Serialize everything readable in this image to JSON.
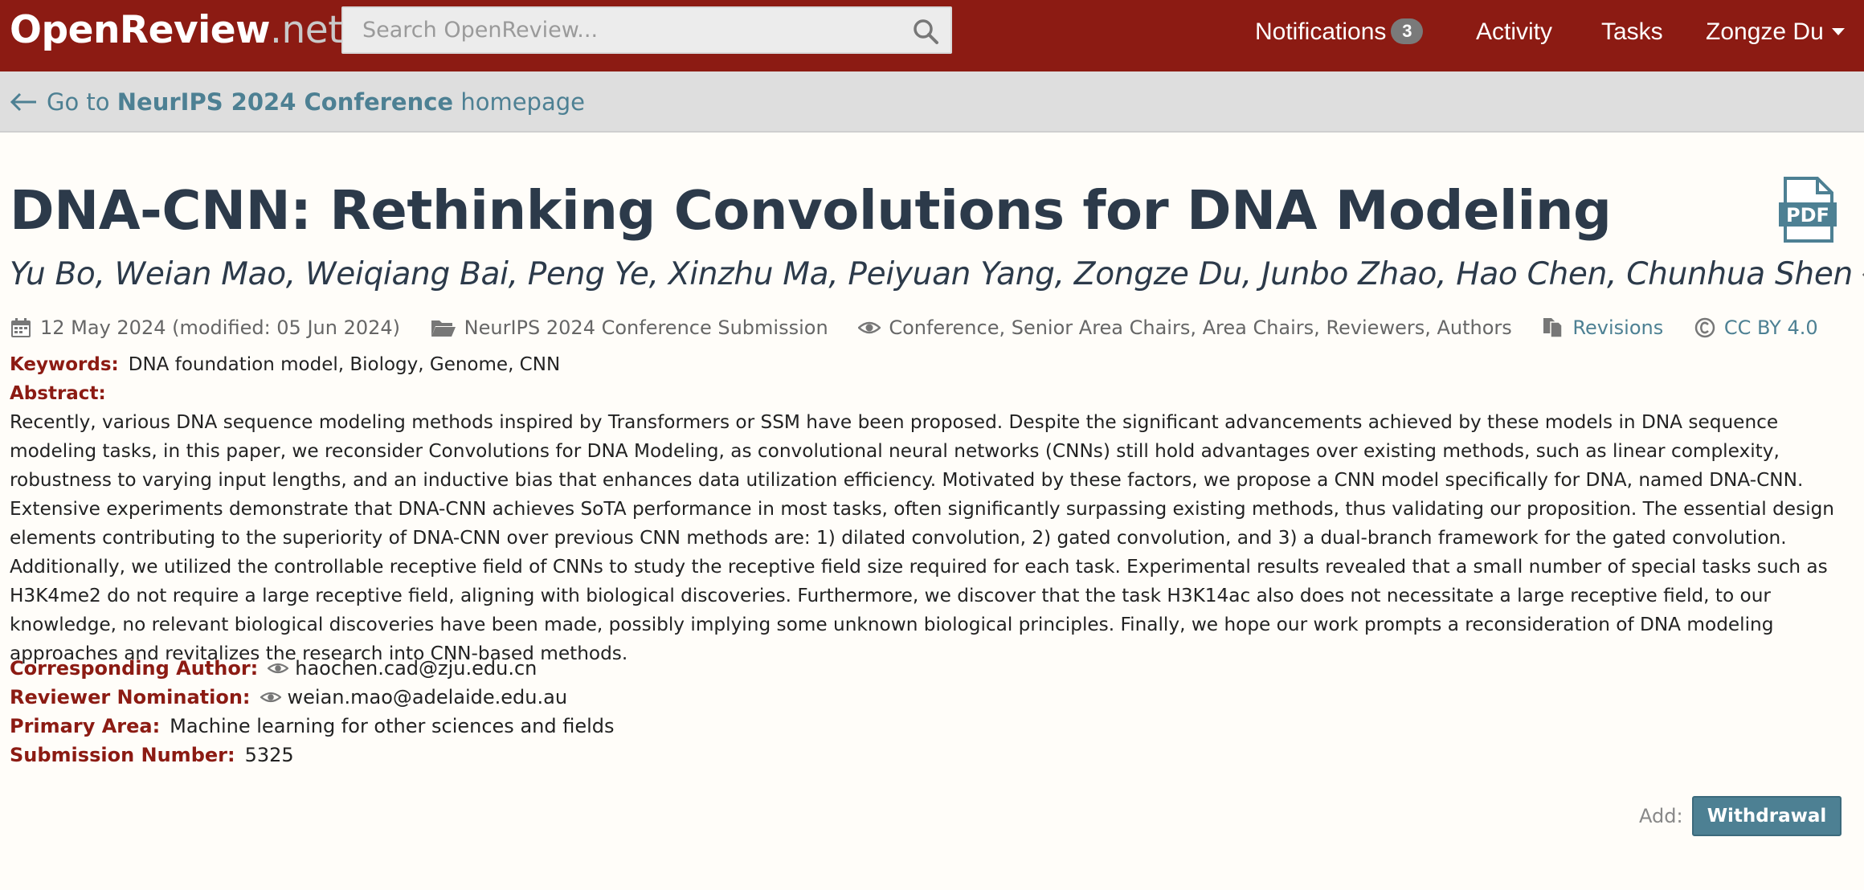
{
  "topnav": {
    "brand_main": "OpenReview",
    "brand_suffix": ".net",
    "search_placeholder": "Search OpenReview...",
    "notifications_label": "Notifications",
    "notifications_count": "3",
    "activity_label": "Activity",
    "tasks_label": "Tasks",
    "user_label": "Zongze Du",
    "bg_color": "#8c1b13"
  },
  "backbar": {
    "prefix": "Go to",
    "venue": "NeurIPS 2024 Conference",
    "suffix": "homepage"
  },
  "paper": {
    "title": "DNA-CNN: Rethinking Convolutions for DNA Modeling",
    "authors": "Yu Bo, Weian Mao, Weiqiang Bai, Peng Ye, Xinzhu Ma, Peiyuan Yang, Zongze Du, Junbo Zhao, Hao Chen, Chunhua Shen",
    "meta": {
      "date": "12 May 2024 (modified: 05 Jun 2024)",
      "venue": "NeurIPS 2024 Conference Submission",
      "readers": "Conference, Senior Area Chairs, Area Chairs, Reviewers, Authors",
      "revisions": "Revisions",
      "license": "CC BY 4.0"
    },
    "keywords_label": "Keywords:",
    "keywords": "DNA foundation model, Biology, Genome, CNN",
    "abstract_label": "Abstract:",
    "abstract": "Recently, various DNA sequence modeling methods inspired by Transformers or SSM have been proposed. Despite the significant advancements achieved by these models in DNA sequence modeling tasks, in this paper, we reconsider Convolutions for DNA Modeling, as convolutional neural networks (CNNs) still hold advantages over existing methods, such as linear complexity, robustness to varying input lengths, and an inductive bias that enhances data utilization efficiency. Motivated by these factors, we propose a CNN model specifically for DNA, named DNA-CNN. Extensive experiments demonstrate that DNA-CNN achieves SoTA performance in most tasks, often significantly surpassing existing methods, thus validating our proposition. The essential design elements contributing to the superiority of DNA-CNN over previous CNN methods are: 1) dilated convolution, 2) gated convolution, and 3) a dual-branch framework for the gated convolution. Additionally, we utilized the controllable receptive field of CNNs to study the receptive field size required for each task. Experimental results revealed that a small number of special tasks such as H3K4me2 do not require a large receptive field, aligning with biological discoveries. Furthermore, we discover that the task H3K14ac also does not necessitate a large receptive field, to our knowledge, no relevant biological discoveries have been made, possibly implying some unknown biological principles. Finally, we hope our work prompts a reconsideration of DNA modeling approaches and revitalizes the research into CNN-based methods.",
    "corresponding_author_label": "Corresponding Author:",
    "corresponding_author": "haochen.cad@zju.edu.cn",
    "reviewer_nomination_label": "Reviewer Nomination:",
    "reviewer_nomination": "weian.mao@adelaide.edu.au",
    "primary_area_label": "Primary Area:",
    "primary_area": "Machine learning for other sciences and fields",
    "submission_number_label": "Submission Number:",
    "submission_number": "5325"
  },
  "actions": {
    "add_label": "Add:",
    "withdrawal_label": "Withdrawal"
  },
  "icons": {
    "search": "search-icon",
    "pdf": "pdf-icon",
    "eye": "eye-icon",
    "calendar": "calendar-icon",
    "folder": "folder-icon",
    "revisions": "documents-icon",
    "license": "copyright-icon",
    "back": "arrow-left-icon"
  }
}
